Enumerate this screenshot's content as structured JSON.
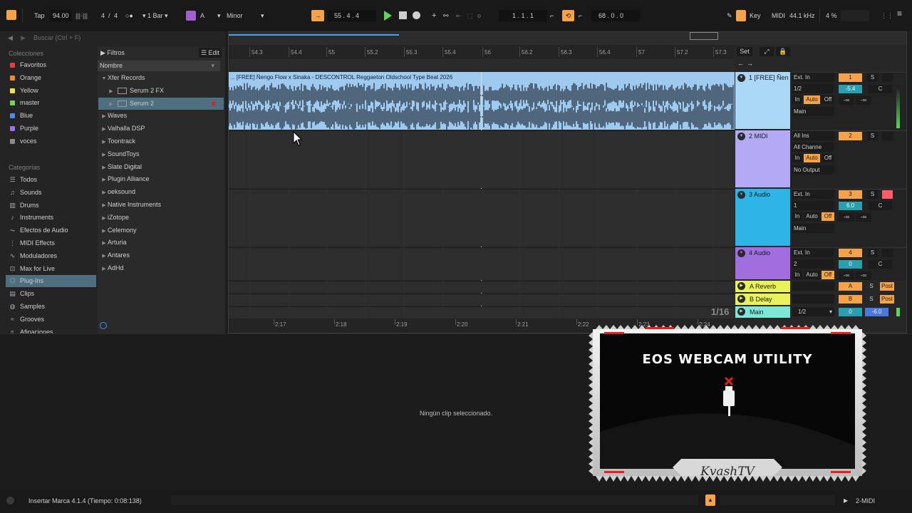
{
  "transport": {
    "tap": "Tap",
    "tempo": "94.00",
    "signature_num": "4",
    "signature_den": "4",
    "quantize": "1 Bar",
    "key_root": "A",
    "scale": "Minor",
    "position": "55 .   4 .   4",
    "loop_start": "1 .   1 .   1",
    "loop_length": "68 .   0 .   0",
    "key_label": "Key",
    "midi_label": "MIDI",
    "sample_rate": "44.1 kHz",
    "cpu": "4 %"
  },
  "browser": {
    "search_placeholder": "Buscar (Ctrl + F)",
    "collections_heading": "Colecciones",
    "collections": [
      {
        "label": "Favoritos",
        "color": "#e0423a"
      },
      {
        "label": "Orange",
        "color": "#f08a2c"
      },
      {
        "label": "Yellow",
        "color": "#f2e34c"
      },
      {
        "label": "master",
        "color": "#6ed35a"
      },
      {
        "label": "Blue",
        "color": "#4a8cf0"
      },
      {
        "label": "Purple",
        "color": "#a06ef0"
      },
      {
        "label": "voces",
        "color": "#8a8a8a"
      }
    ],
    "categories_heading": "Categorías",
    "categories": [
      {
        "label": "Todos",
        "icon": "list-icon"
      },
      {
        "label": "Sounds",
        "icon": "sounds-icon"
      },
      {
        "label": "Drums",
        "icon": "drums-icon"
      },
      {
        "label": "Instruments",
        "icon": "instruments-icon"
      },
      {
        "label": "Efectos de Audio",
        "icon": "audio-fx-icon"
      },
      {
        "label": "MIDI Effects",
        "icon": "midi-fx-icon"
      },
      {
        "label": "Moduladores",
        "icon": "modulators-icon"
      },
      {
        "label": "Max for Live",
        "icon": "max-icon"
      },
      {
        "label": "Plug-Ins",
        "icon": "plugins-icon"
      },
      {
        "label": "Clips",
        "icon": "clips-icon"
      },
      {
        "label": "Samples",
        "icon": "samples-icon"
      },
      {
        "label": "Grooves",
        "icon": "grooves-icon"
      },
      {
        "label": "Afinaciones",
        "icon": "tunings-icon"
      }
    ],
    "filters_label": "Filtros",
    "edit_label": "Edit",
    "name_header": "Nombre",
    "tree": [
      {
        "label": "Xfer Records",
        "level": 0,
        "open": true
      },
      {
        "label": "Serum 2 FX",
        "level": 1,
        "open": false
      },
      {
        "label": "Serum 2",
        "level": 1,
        "open": false
      },
      {
        "label": "Waves",
        "level": 0,
        "open": false
      },
      {
        "label": "Valhalla DSP",
        "level": 0,
        "open": false
      },
      {
        "label": "Toontrack",
        "level": 0,
        "open": false
      },
      {
        "label": "SoundToys",
        "level": 0,
        "open": false
      },
      {
        "label": "Slate Digital",
        "level": 0,
        "open": false
      },
      {
        "label": "Plugin Alliance",
        "level": 0,
        "open": false
      },
      {
        "label": "oeksound",
        "level": 0,
        "open": false
      },
      {
        "label": "Native Instruments",
        "level": 0,
        "open": false
      },
      {
        "label": "iZotope",
        "level": 0,
        "open": false
      },
      {
        "label": "Celemony",
        "level": 0,
        "open": false
      },
      {
        "label": "Arturia",
        "level": 0,
        "open": false
      },
      {
        "label": "Antares",
        "level": 0,
        "open": false
      },
      {
        "label": "AdHd",
        "level": 0,
        "open": false
      }
    ]
  },
  "arrangement": {
    "ruler": [
      "54.3",
      "54.4",
      "55",
      "55.2",
      "55.3",
      "55.4",
      "56",
      "56.2",
      "56.3",
      "56.4",
      "57",
      "57.2",
      "57.3"
    ],
    "set_label": "Set",
    "time_ruler": [
      "2:17",
      "2:18",
      "2:19",
      "2:20",
      "2:21",
      "2:22",
      "2:23",
      "2:24"
    ],
    "grid_fraction": "1/16",
    "clip_title": "... [FREE] Ñengo Flow x Sinaka - DESCONTROL  Reggaeton Oldschool Type Beat 2026"
  },
  "tracks": [
    {
      "name": "1 [FREE] Ñen",
      "color": "#a9d7f5",
      "input": "Ext. In",
      "channel": "1/2",
      "monitor": [
        "In",
        "Auto",
        "Off"
      ],
      "output": "Main",
      "number": "1",
      "volume": "-5.4",
      "pan": "C",
      "sends": [
        "-∞",
        "-∞"
      ]
    },
    {
      "name": "2 MIDI",
      "color": "#b3a9f5",
      "input": "All Ins",
      "channel": "All Channe",
      "monitor": [
        "In",
        "Auto",
        "Off"
      ],
      "output": "No Output",
      "number": "2",
      "volume": "",
      "pan": "",
      "sends": []
    },
    {
      "name": "3 Audio",
      "color": "#2fb4e8",
      "input": "Ext. In",
      "channel": "1",
      "monitor": [
        "In",
        "Auto",
        "Off"
      ],
      "output": "Main",
      "number": "3",
      "volume": "6.0",
      "pan": "C",
      "sends": [
        "-∞",
        "-∞"
      ]
    },
    {
      "name": "4 Audio",
      "color": "#a16ee0",
      "input": "Ext. In",
      "channel": "2",
      "monitor": [
        "In",
        "Auto",
        "Off"
      ],
      "output": "",
      "number": "4",
      "volume": "0",
      "pan": "C",
      "sends": [
        "-∞",
        "-∞"
      ]
    }
  ],
  "returns": [
    {
      "name": "A Reverb",
      "color": "#e9f25a",
      "letter": "A",
      "post": "Post"
    },
    {
      "name": "B Delay",
      "color": "#e9f25a",
      "letter": "B",
      "post": "Post"
    }
  ],
  "master": {
    "name": "Main",
    "color": "#7ee8d8",
    "channel": "1/2",
    "volume": "0",
    "level": "-6.0"
  },
  "detail": {
    "empty_message": "Ningún clip seleccionado."
  },
  "status": {
    "message": "Insertar Marca 4.1.4 (Tiempo: 0:08:138)",
    "selected_track": "2-MIDI"
  },
  "webcam": {
    "title": "EOS WEBCAM UTILITY",
    "watermark": "KvashTV"
  }
}
